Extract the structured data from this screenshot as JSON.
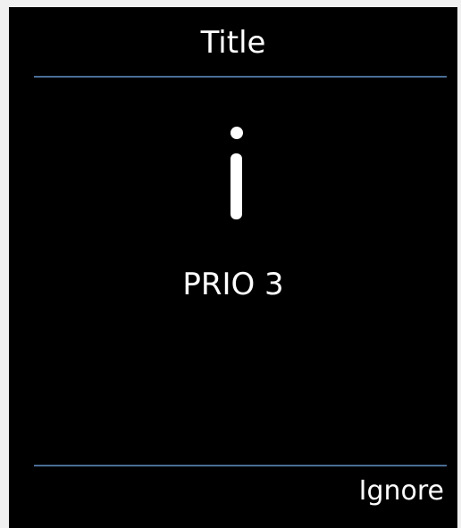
{
  "dialog": {
    "title": "Title",
    "icon": "info-icon",
    "message": "PRIO 3",
    "softkey_label": "Ignore"
  },
  "colors": {
    "background": "#000000",
    "text": "#ffffff",
    "divider": "#4a6e96"
  }
}
